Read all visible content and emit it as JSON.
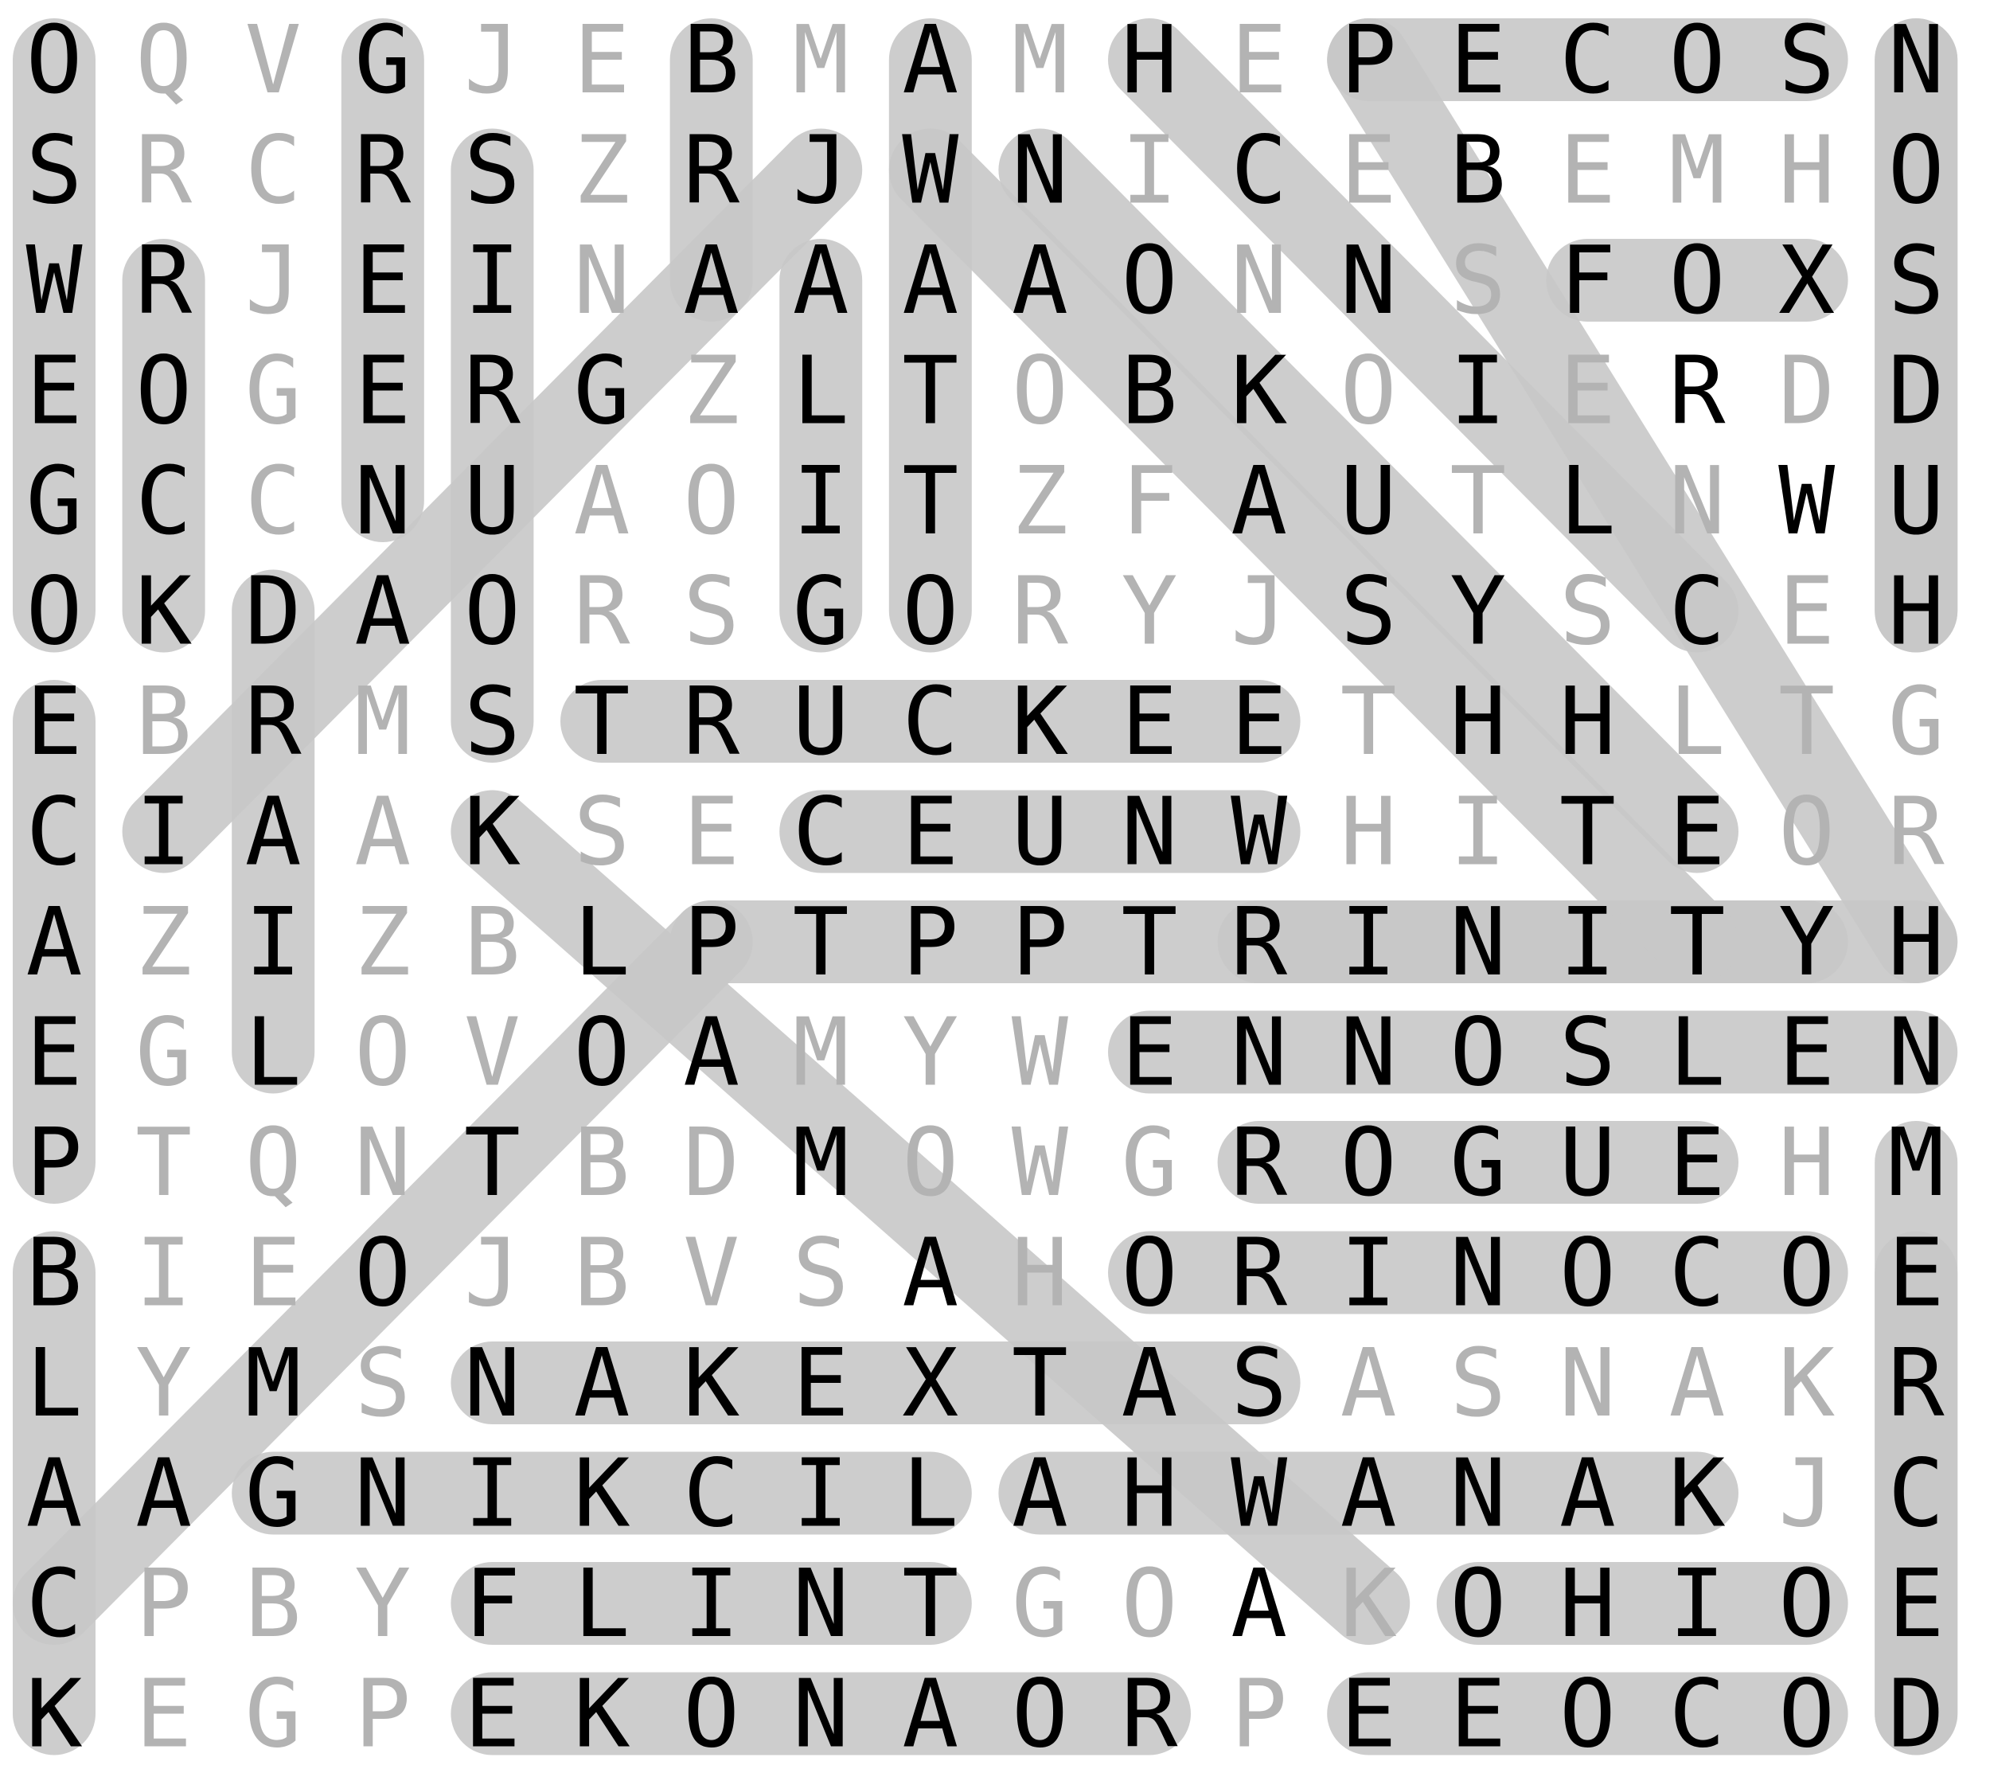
{
  "puzzle": {
    "rows": [
      "OQVGJEBMAMHEPECOSN",
      "SRCRSZRJWNICEBEMHO",
      "WRJEINAAAAONNSFOXS",
      "EOGERGZLTOBKOIERDD",
      "GCCNUAOITZFAUTLNWU",
      "OKDAORSGORYJSYSCEH",
      "EBRMSTRUCKEETHHLTG",
      "CIAAKSECEUNWHITEOR",
      "AZIZBLPTPPTRINITYH",
      "EGLOVOAMYWENNOSLEN",
      "PTQNTBDMOWGROGUEHM",
      "BIEOJBVSAHORINOCOE",
      "LYMSNAKEXTASASNAKR",
      "AAGNIKCILAHWANAKJC",
      "CPBYFLINTGOAKOHIOE",
      "KEGPEKONAORPEEOCOD"
    ],
    "found_words": [
      {
        "start": [
          0,
          0
        ],
        "end": [
          5,
          0
        ]
      },
      {
        "start": [
          6,
          0
        ],
        "end": [
          10,
          0
        ]
      },
      {
        "start": [
          11,
          0
        ],
        "end": [
          15,
          0
        ]
      },
      {
        "start": [
          2,
          1
        ],
        "end": [
          5,
          1
        ]
      },
      {
        "start": [
          0,
          3
        ],
        "end": [
          4,
          3
        ]
      },
      {
        "start": [
          1,
          4
        ],
        "end": [
          6,
          4
        ]
      },
      {
        "start": [
          0,
          6
        ],
        "end": [
          2,
          6
        ]
      },
      {
        "start": [
          5,
          2
        ],
        "end": [
          9,
          2
        ]
      },
      {
        "start": [
          2,
          7
        ],
        "end": [
          5,
          7
        ]
      },
      {
        "start": [
          0,
          8
        ],
        "end": [
          5,
          8
        ]
      },
      {
        "start": [
          0,
          17
        ],
        "end": [
          5,
          17
        ]
      },
      {
        "start": [
          10,
          17
        ],
        "end": [
          15,
          17
        ]
      },
      {
        "start": [
          0,
          12
        ],
        "end": [
          0,
          16
        ]
      },
      {
        "start": [
          2,
          14
        ],
        "end": [
          2,
          16
        ]
      },
      {
        "start": [
          6,
          5
        ],
        "end": [
          6,
          11
        ]
      },
      {
        "start": [
          7,
          7
        ],
        "end": [
          7,
          11
        ]
      },
      {
        "start": [
          8,
          6
        ],
        "end": [
          8,
          16
        ]
      },
      {
        "start": [
          8,
          11
        ],
        "end": [
          8,
          17
        ]
      },
      {
        "start": [
          9,
          10
        ],
        "end": [
          9,
          17
        ]
      },
      {
        "start": [
          10,
          11
        ],
        "end": [
          10,
          15
        ]
      },
      {
        "start": [
          11,
          10
        ],
        "end": [
          11,
          16
        ]
      },
      {
        "start": [
          12,
          4
        ],
        "end": [
          12,
          11
        ]
      },
      {
        "start": [
          13,
          2
        ],
        "end": [
          13,
          8
        ]
      },
      {
        "start": [
          13,
          9
        ],
        "end": [
          13,
          15
        ]
      },
      {
        "start": [
          14,
          4
        ],
        "end": [
          14,
          8
        ]
      },
      {
        "start": [
          14,
          13
        ],
        "end": [
          14,
          16
        ]
      },
      {
        "start": [
          15,
          4
        ],
        "end": [
          15,
          10
        ]
      },
      {
        "start": [
          15,
          12
        ],
        "end": [
          15,
          16
        ]
      },
      {
        "start": [
          0,
          10
        ],
        "end": [
          5,
          15
        ]
      },
      {
        "start": [
          1,
          9
        ],
        "end": [
          7,
          15
        ]
      },
      {
        "start": [
          1,
          8
        ],
        "end": [
          8,
          15
        ]
      },
      {
        "start": [
          0,
          12
        ],
        "end": [
          8,
          17
        ]
      },
      {
        "start": [
          7,
          4
        ],
        "end": [
          14,
          12
        ]
      },
      {
        "start": [
          7,
          1
        ],
        "end": [
          1,
          7
        ]
      },
      {
        "start": [
          14,
          0
        ],
        "end": [
          8,
          6
        ]
      },
      {
        "start": [
          0,
          17
        ],
        "end": [
          5,
          17
        ]
      },
      {
        "start": [
          11,
          17
        ],
        "end": [
          15,
          17
        ]
      }
    ]
  }
}
